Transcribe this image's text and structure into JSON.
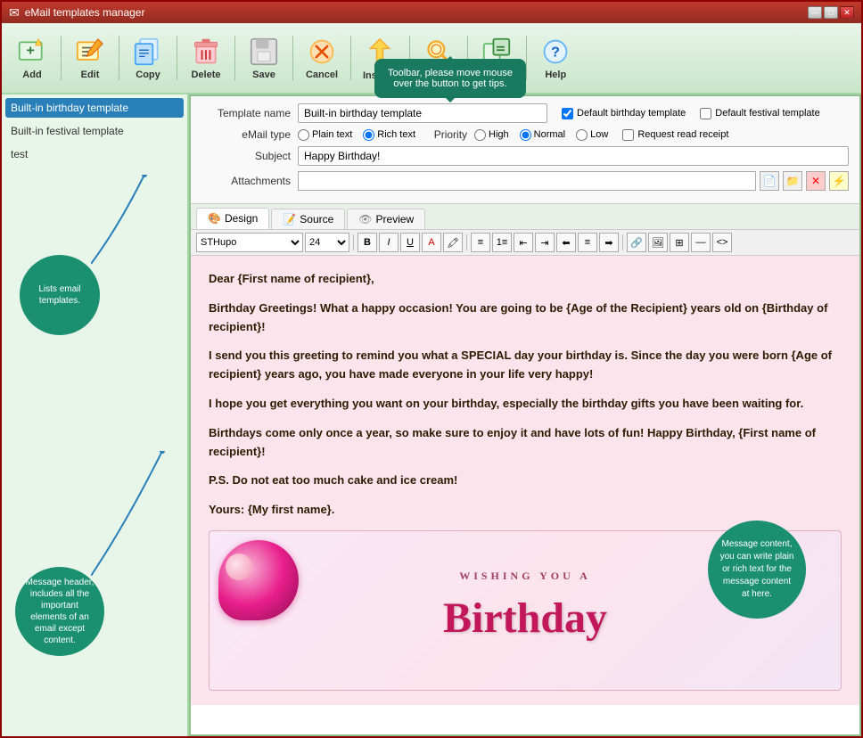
{
  "window": {
    "title": "eMail templates manager",
    "controls": {
      "minimize": "—",
      "maximize": "□",
      "close": "✕"
    }
  },
  "toolbar": {
    "buttons": [
      {
        "id": "add",
        "label": "Add",
        "icon": "add-icon"
      },
      {
        "id": "edit",
        "label": "Edit",
        "icon": "edit-icon"
      },
      {
        "id": "copy",
        "label": "Copy",
        "icon": "copy-icon"
      },
      {
        "id": "delete",
        "label": "Delete",
        "icon": "delete-icon"
      },
      {
        "id": "save",
        "label": "Save",
        "icon": "save-icon"
      },
      {
        "id": "cancel",
        "label": "Cancel",
        "icon": "cancel-icon"
      },
      {
        "id": "insert",
        "label": "Insert ▾",
        "icon": "insert-icon"
      },
      {
        "id": "search",
        "label": "Search",
        "icon": "search-icon"
      },
      {
        "id": "expand",
        "label": "Expand",
        "icon": "expand-icon"
      },
      {
        "id": "help",
        "label": "Help",
        "icon": "help-icon"
      }
    ]
  },
  "sidebar": {
    "items": [
      {
        "id": "birthday",
        "label": "Built-in birthday template",
        "active": true
      },
      {
        "id": "festival",
        "label": "Built-in festival template",
        "active": false
      },
      {
        "id": "test",
        "label": "test",
        "active": false
      }
    ],
    "tooltip1": {
      "text": "Lists email templates."
    },
    "tooltip2": {
      "text": "Message header, includes all the important elements of an email except content."
    }
  },
  "form": {
    "template_name_label": "Template name",
    "template_name_value": "Built-in birthday template",
    "default_birthday_label": "Default birthday template",
    "default_festival_label": "Default festival template",
    "email_type_label": "eMail type",
    "email_type_options": [
      "Plain text",
      "Rich text"
    ],
    "email_type_selected": "Rich text",
    "priority_label": "Priority",
    "priority_options": [
      "High",
      "Normal",
      "Low"
    ],
    "priority_selected": "Normal",
    "request_read_receipt_label": "Request read receipt",
    "subject_label": "Subject",
    "subject_value": "Happy Birthday!",
    "attachments_label": "Attachments"
  },
  "editor": {
    "tabs": [
      {
        "id": "design",
        "label": "Design",
        "active": true
      },
      {
        "id": "source",
        "label": "Source",
        "active": false
      },
      {
        "id": "preview",
        "label": "Preview",
        "active": false
      }
    ],
    "toolbar": {
      "font_family": "STHupo",
      "font_size": "24"
    },
    "content": {
      "para1": "Dear {First name of recipient},",
      "para2": "Birthday Greetings! What a happy occasion! You are going to be {Age of the Recipient} years old on {Birthday of recipient}!",
      "para3": "I send you this greeting to remind you what a SPECIAL day your birthday is. Since the day you were born {Age of recipient} years ago, you have made everyone in your life very happy!",
      "para4": "I hope you get everything you want on your birthday, especially the birthday gifts you have been waiting for.",
      "para5": "Birthdays come only once a year, so make sure to enjoy it and have lots of fun! Happy Birthday, {First name of recipient}!",
      "para6": "P.S. Do not eat too much cake and ice cream!",
      "para7": "Yours: {My first name}."
    },
    "card": {
      "top_text": "WISHING YOU A",
      "main_text": "Birthday"
    }
  },
  "tooltip_toolbar": {
    "text": "Toolbar, please move mouse over the button to get tips."
  },
  "tooltip_content": {
    "text": "Message content, you can write plain or rich text for the message content at here."
  },
  "colors": {
    "accent_green": "#2e7d32",
    "light_green_bg": "#e8f5e9",
    "toolbar_bg": "#c8e6c9",
    "sidebar_active": "#2980b9",
    "tooltip_bg": "#1a9070",
    "editor_bg": "#fce4ec",
    "title_bar_bg": "#c0392b"
  }
}
